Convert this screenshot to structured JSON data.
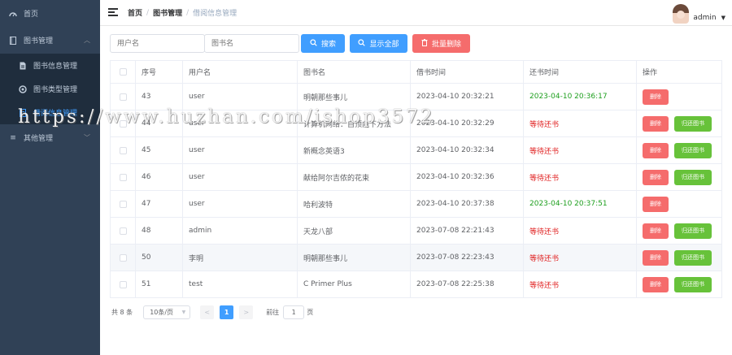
{
  "sidebar": {
    "items": [
      {
        "label": "首页",
        "icon": "dashboard-icon"
      },
      {
        "label": "图书管理",
        "icon": "book-icon"
      },
      {
        "label": "图书信息管理",
        "icon": "document-icon"
      },
      {
        "label": "图书类型管理",
        "icon": "settings-circle-icon"
      },
      {
        "label": "借阅信息管理",
        "icon": "list-icon"
      },
      {
        "label": "其他管理",
        "icon": "menu-icon"
      }
    ]
  },
  "header": {
    "breadcrumb": [
      "首页",
      "图书管理",
      "借阅信息管理"
    ],
    "user_name": "admin"
  },
  "search": {
    "username_placeholder": "用户名",
    "bookname_placeholder": "图书名",
    "search_label": "搜索",
    "show_all_label": "显示全部",
    "batch_delete_label": "批量删除"
  },
  "table": {
    "columns": [
      "序号",
      "用户名",
      "图书名",
      "借书时间",
      "还书时间",
      "操作"
    ],
    "rows": [
      {
        "id": "43",
        "user": "user",
        "book": "明朝那些事儿",
        "borrow": "2023-04-10 20:32:21",
        "return": "2023-04-10 20:36:17",
        "returned": true
      },
      {
        "id": "44",
        "user": "user",
        "book": "计算机网络：自顶向下方法",
        "borrow": "2023-04-10 20:32:29",
        "return": "等待还书",
        "returned": false
      },
      {
        "id": "45",
        "user": "user",
        "book": "新概念英语3",
        "borrow": "2023-04-10 20:32:34",
        "return": "等待还书",
        "returned": false
      },
      {
        "id": "46",
        "user": "user",
        "book": "献给阿尔吉侬的花束",
        "borrow": "2023-04-10 20:32:36",
        "return": "等待还书",
        "returned": false
      },
      {
        "id": "47",
        "user": "user",
        "book": "哈利波特",
        "borrow": "2023-04-10 20:37:38",
        "return": "2023-04-10 20:37:51",
        "returned": true
      },
      {
        "id": "48",
        "user": "admin",
        "book": "天龙八部",
        "borrow": "2023-07-08 22:21:43",
        "return": "等待还书",
        "returned": false
      },
      {
        "id": "50",
        "user": "李明",
        "book": "明朝那些事儿",
        "borrow": "2023-07-08 22:23:43",
        "return": "等待还书",
        "returned": false
      },
      {
        "id": "51",
        "user": "test",
        "book": "C Primer Plus",
        "borrow": "2023-07-08 22:25:38",
        "return": "等待还书",
        "returned": false
      }
    ],
    "delete_label": "删除",
    "return_label": "归还图书"
  },
  "pagination": {
    "total_text": "共 8 条",
    "page_size": "10条/页",
    "prev": "<",
    "current_page": "1",
    "next": ">",
    "goto_label": "前往",
    "goto_value": "1",
    "page_suffix": "页"
  },
  "watermark": "https://www.huzhan.com/ishop3572",
  "colors": {
    "sidebar_bg": "#304156",
    "primary": "#409eff",
    "danger": "#f56c6c",
    "success": "#67c23a",
    "returned_text": "#1e9f1e",
    "waiting_text": "#e02020"
  }
}
